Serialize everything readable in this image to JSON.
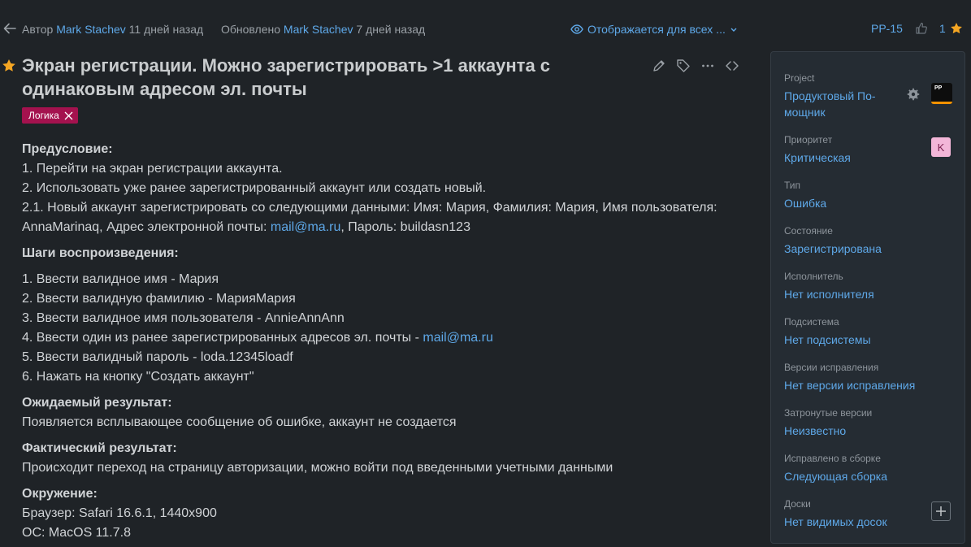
{
  "header": {
    "author_label": "Автор",
    "author_name": "Mark Stachev",
    "author_time": "11 дней назад",
    "updated_label": "Обновлено",
    "updated_name": "Mark Stachev",
    "updated_time": "7 дней назад",
    "visibility": "Отображается для всех ...",
    "issue_id": "PP-15",
    "star_count": "1"
  },
  "issue": {
    "title": "Экран регистрации. Можно зарегистрировать >1 аккаунта с одинаковым адресом эл. почты",
    "tag": "Логика"
  },
  "description": {
    "pre_heading": "Предусловие:",
    "pre_1": "1. Перейти на экран регистрации аккаунта.",
    "pre_2": "2. Использовать уже ранее зарегистрированный аккаунт или создать новый.",
    "pre_21_a": "2.1. Новый аккаунт зарегистрировать со следующими данными: Имя: Мария, Фамилия: Мария, Имя пользователя: AnnaMarinaq, Адрес электронной почты: ",
    "pre_21_email": "mail@ma.ru",
    "pre_21_b": ", Пароль: buildasn123",
    "steps_heading": "Шаги воспроизведения:",
    "step_1": "1. Ввести валидное имя - Мария",
    "step_2": "2. Ввести валидную фамилию - МарияМария",
    "step_3": "3. Ввести валидное имя пользователя - AnnieAnnAnn",
    "step_4_a": "4. Ввести один из ранее зарегистрированных адресов эл. почты - ",
    "step_4_email": "mail@ma.ru",
    "step_5": "5. Ввести валидный пароль - loda.12345loadf",
    "step_6": "6. Нажать на кнопку \"Создать аккаунт\"",
    "expected_heading": "Ожидаемый результат:",
    "expected_text": "Появляется всплывающее сообщение об ошибке, аккаунт не создается",
    "actual_heading": "Фактический результат:",
    "actual_text": "Происходит переход на страницу авторизации, можно войти под введенными учетными данными",
    "env_heading": "Окружение:",
    "env_browser": "Браузер: Safari 16.6.1, 1440x900",
    "env_os": "ОС: MacOS 11.7.8"
  },
  "panel": {
    "project_label": "Project",
    "project_value": "Продуктовый По-мощник",
    "project_logo": "PP",
    "priority_label": "Приоритет",
    "priority_value": "Критическая",
    "priority_badge": "K",
    "type_label": "Тип",
    "type_value": "Ошибка",
    "state_label": "Состояние",
    "state_value": "Зарегистрирована",
    "assignee_label": "Исполнитель",
    "assignee_value": "Нет исполнителя",
    "subsystem_label": "Подсистема",
    "subsystem_value": "Нет подсистемы",
    "fix_versions_label": "Версии исправления",
    "fix_versions_value": "Нет версии исправления",
    "affected_label": "Затронутые версии",
    "affected_value": "Неизвестно",
    "fixed_build_label": "Исправлено в сборке",
    "fixed_build_value": "Следующая сборка",
    "boards_label": "Доски",
    "boards_value": "Нет видимых досок"
  },
  "colors": {
    "background": "#1f2327",
    "panel": "#252c33",
    "link": "#5ea8e8",
    "star": "#f5a623",
    "tag": "#a4124e"
  }
}
